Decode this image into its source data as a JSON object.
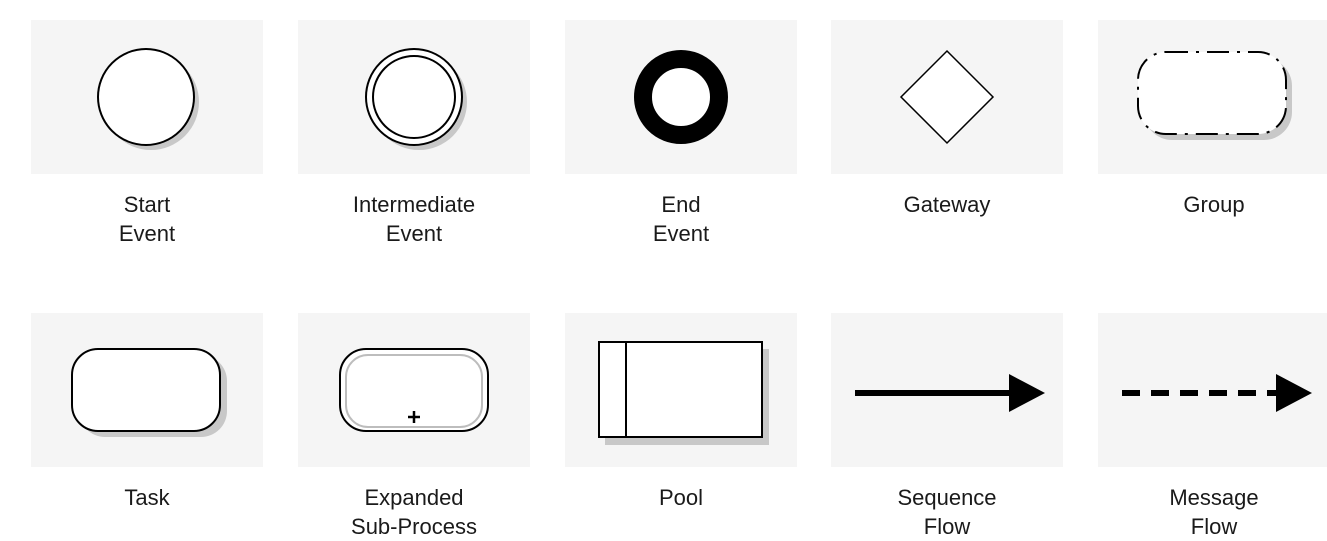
{
  "shapes": [
    {
      "id": "start-event",
      "label_lines": [
        "Start",
        "Event"
      ],
      "icon": "start-event-icon"
    },
    {
      "id": "intermediate-event",
      "label_lines": [
        "Intermediate",
        "Event"
      ],
      "icon": "intermediate-event-icon"
    },
    {
      "id": "end-event",
      "label_lines": [
        "End",
        "Event"
      ],
      "icon": "end-event-icon"
    },
    {
      "id": "gateway",
      "label_lines": [
        "Gateway"
      ],
      "icon": "gateway-icon"
    },
    {
      "id": "group",
      "label_lines": [
        "Group"
      ],
      "icon": "group-icon"
    },
    {
      "id": "task",
      "label_lines": [
        "Task"
      ],
      "icon": "task-icon"
    },
    {
      "id": "expanded-sub-process",
      "label_lines": [
        "Expanded",
        "Sub-Process"
      ],
      "icon": "expanded-sub-process-icon"
    },
    {
      "id": "pool",
      "label_lines": [
        "Pool"
      ],
      "icon": "pool-icon"
    },
    {
      "id": "sequence-flow",
      "label_lines": [
        "Sequence",
        "Flow"
      ],
      "icon": "sequence-flow-icon"
    },
    {
      "id": "message-flow",
      "label_lines": [
        "Message",
        "Flow"
      ],
      "icon": "message-flow-icon"
    }
  ],
  "colors": {
    "tile": "#f5f5f5",
    "stroke": "#000000",
    "shadow": "#c8c8c8",
    "text": "#1a1a1a"
  }
}
